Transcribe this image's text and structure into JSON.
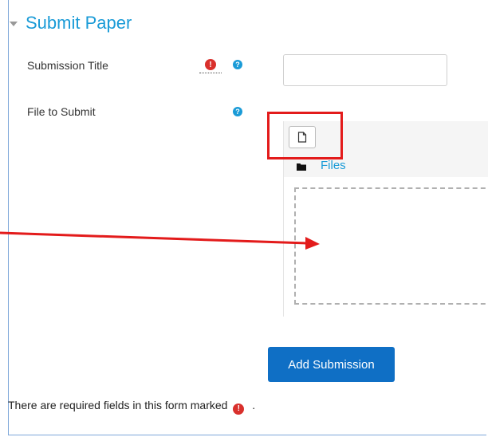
{
  "form": {
    "legend": "Submit Paper",
    "fields": {
      "title_label": "Submission Title",
      "file_label": "File to Submit",
      "files_link": "Files"
    },
    "submit_label": "Add Submission",
    "required_note_prefix": "There are required fields in this form marked",
    "required_note_suffix": "."
  },
  "icons": {
    "required": "!",
    "help": "?"
  },
  "colors": {
    "accent": "#1a9bd7",
    "button": "#0f6fc5",
    "required": "#d9302c",
    "annotation": "#e31b1b"
  }
}
